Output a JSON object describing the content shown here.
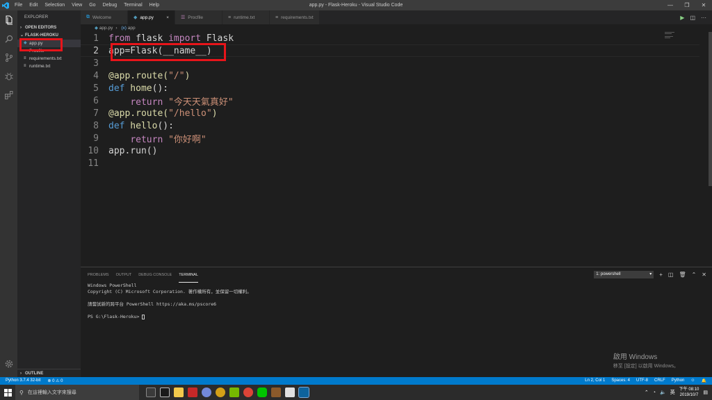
{
  "window": {
    "title": "app.py - Flask-Heroku - Visual Studio Code",
    "menu": [
      "File",
      "Edit",
      "Selection",
      "View",
      "Go",
      "Debug",
      "Terminal",
      "Help"
    ],
    "controls": [
      "—",
      "❐",
      "✕"
    ]
  },
  "sidebar": {
    "title": "EXPLORER",
    "open_editors": "OPEN EDITORS",
    "folder": "FLASK-HEROKU",
    "files": [
      {
        "name": "app.py",
        "icon": "python-file-icon",
        "active": true
      },
      {
        "name": "Procfile",
        "icon": "file-icon",
        "active": false
      },
      {
        "name": "requirements.txt",
        "icon": "text-file-icon",
        "active": false
      },
      {
        "name": "runtime.txt",
        "icon": "text-file-icon",
        "active": false
      }
    ],
    "outline": "OUTLINE"
  },
  "tabs": [
    {
      "label": "Welcome",
      "icon": "vscode-icon",
      "active": false
    },
    {
      "label": "app.py",
      "icon": "python-file-icon",
      "active": true,
      "close": "×"
    },
    {
      "label": "Procfile",
      "icon": "file-icon",
      "active": false
    },
    {
      "label": "runtime.txt",
      "icon": "text-file-icon",
      "active": false
    },
    {
      "label": "requirements.txt",
      "icon": "text-file-icon",
      "active": false
    }
  ],
  "breadcrumb": {
    "file": "app.py",
    "symbol": "app",
    "sep": "›"
  },
  "code": {
    "line_numbers": [
      "1",
      "2",
      "3",
      "4",
      "5",
      "6",
      "7",
      "8",
      "9",
      "10",
      "11"
    ],
    "l1": {
      "kw1": "from",
      "mod": " flask ",
      "kw2": "import",
      "cls": " Flask"
    },
    "l2": {
      "a": "app=Flask(",
      "b": "__name__",
      "c": ")"
    },
    "l4": {
      "dec": "@app.route(",
      "str": "\"/\"",
      "end": ")"
    },
    "l5": {
      "kw": "def",
      "fn": " home",
      "end": "():"
    },
    "l6": {
      "kw": "return",
      "str": " \"今天天氣真好\""
    },
    "l7": {
      "dec": "@app.route(",
      "str": "\"/hello\"",
      "end": ")"
    },
    "l8": {
      "kw": "def",
      "fn": " hello",
      "end": "():"
    },
    "l9": {
      "kw": "return",
      "str": " \"你好啊\""
    },
    "l10": {
      "a": "app.run()"
    }
  },
  "panel": {
    "tabs": [
      "PROBLEMS",
      "OUTPUT",
      "DEBUG CONSOLE",
      "TERMINAL"
    ],
    "active_tab": "TERMINAL",
    "terminal_select": "1: powershell",
    "terminal_lines": [
      "Windows PowerShell",
      "Copyright (C) Microsoft Corporation. 著作權所有，並保留一切權利。",
      "",
      "請嘗試新的跨平台 PowerShell https://aka.ms/pscore6",
      ""
    ],
    "prompt": "PS G:\\Flask-Heroku> "
  },
  "watermark": {
    "line1": "啟用 Windows",
    "line2": "移至 [設定] 以啟用 Windows。"
  },
  "statusbar": {
    "python": "Python 3.7.4 32-bit",
    "errors": "⊗ 0 ⚠ 0",
    "position": "Ln 2, Col 1",
    "spaces": "Spaces: 4",
    "encoding": "UTF-8",
    "eol": "CRLF",
    "language": "Python"
  },
  "taskbar": {
    "search_placeholder": "在這裡輸入文字來搜尋",
    "ime": "英",
    "time": "下午 08:10",
    "date": "2019/10/7"
  },
  "colors": {
    "highlight": "#e8141a",
    "accent": "#007acc"
  }
}
